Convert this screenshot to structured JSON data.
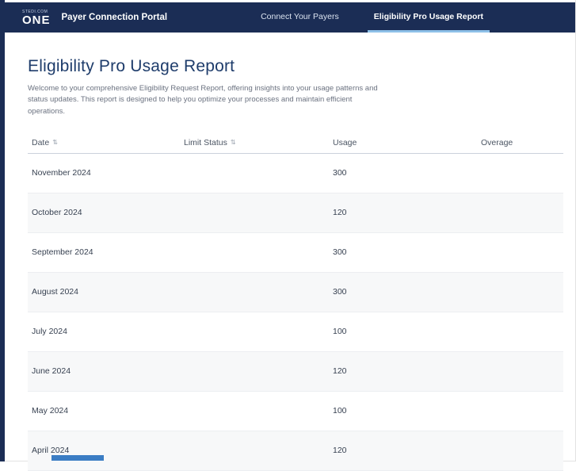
{
  "navbar": {
    "logo_small": "STEDI.COM",
    "logo_main": "ONE",
    "app_title": "Payer Connection Portal",
    "nav_items": [
      {
        "label": "Connect Your Payers",
        "active": false
      },
      {
        "label": "Eligibility Pro Usage Report",
        "active": true
      }
    ]
  },
  "page": {
    "title": "Eligibility Pro Usage Report",
    "description": "Welcome to your comprehensive Eligibility Request Report, offering insights into your usage patterns and status updates. This report is designed to help you optimize your processes and maintain efficient operations."
  },
  "icons": {
    "sort": "⇅"
  },
  "colors": {
    "navbar_bg": "#1b2d55",
    "active_tab_underline": "#8ec0e8",
    "title_text": "#1e3c6b",
    "body_text": "#6b7280",
    "row_alt_bg": "#f7f8f9",
    "bottom_bar": "#3b7dc4"
  },
  "table": {
    "columns": [
      {
        "label": "Date",
        "sortable": true
      },
      {
        "label": "Limit Status",
        "sortable": true
      },
      {
        "label": "Usage",
        "sortable": false
      },
      {
        "label": "Overage",
        "sortable": false
      }
    ],
    "rows": [
      {
        "date": "November 2024",
        "limit_status": "",
        "usage": "300",
        "overage": ""
      },
      {
        "date": "October 2024",
        "limit_status": "",
        "usage": "120",
        "overage": ""
      },
      {
        "date": "September 2024",
        "limit_status": "",
        "usage": "300",
        "overage": ""
      },
      {
        "date": "August 2024",
        "limit_status": "",
        "usage": "300",
        "overage": ""
      },
      {
        "date": "July 2024",
        "limit_status": "",
        "usage": "100",
        "overage": ""
      },
      {
        "date": "June 2024",
        "limit_status": "",
        "usage": "120",
        "overage": ""
      },
      {
        "date": "May 2024",
        "limit_status": "",
        "usage": "100",
        "overage": ""
      },
      {
        "date": "April 2024",
        "limit_status": "",
        "usage": "120",
        "overage": ""
      }
    ]
  }
}
